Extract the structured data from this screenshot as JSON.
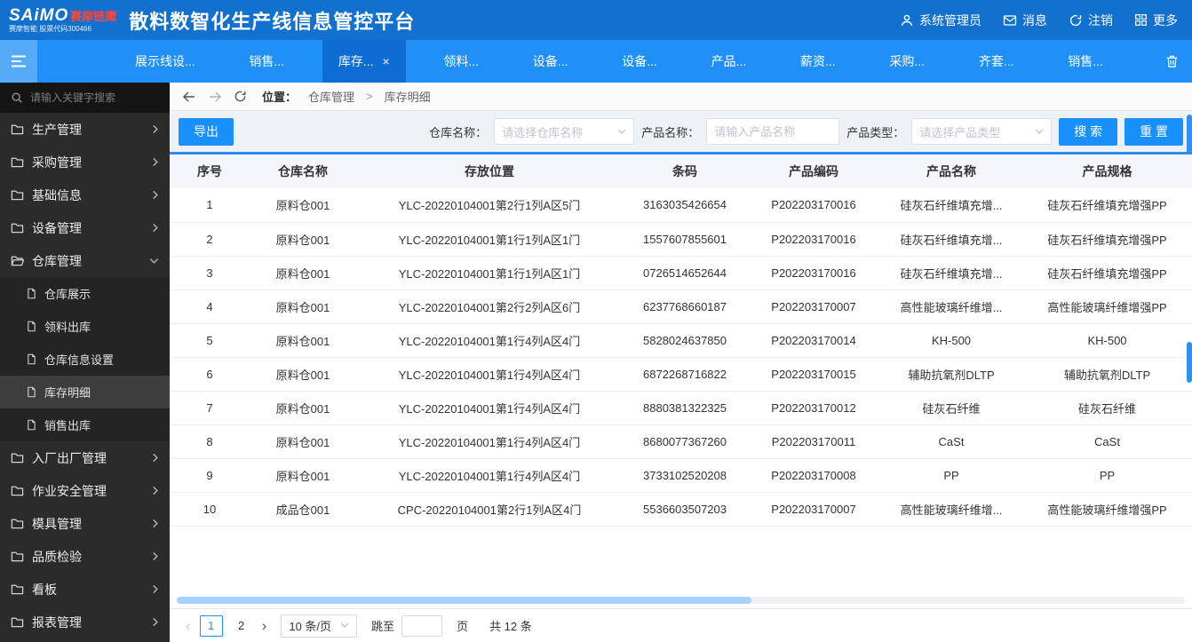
{
  "colors": {
    "primary": "#1890ff",
    "topbar": "#1270cf",
    "tabbar": "#2090f8",
    "tab_active": "#0e6dd2",
    "sidebar": "#2b2b2b",
    "accent": "#2e90f5"
  },
  "header": {
    "logo_main": "SAiMO",
    "logo_sub": "赛摩链鹰",
    "logo_tagline": "赛摩智能 股票代码300466",
    "title": "散料数智化生产线信息管控平台",
    "user": "系统管理员",
    "messages": "消息",
    "logout": "注销",
    "more": "更多"
  },
  "tabbar": {
    "tabs": [
      {
        "label": "展示线设...",
        "active": false
      },
      {
        "label": "销售...",
        "active": false
      },
      {
        "label": "库存...",
        "active": true
      },
      {
        "label": "领料...",
        "active": false
      },
      {
        "label": "设备...",
        "active": false
      },
      {
        "label": "设备...",
        "active": false
      },
      {
        "label": "产品...",
        "active": false
      },
      {
        "label": "薪资...",
        "active": false
      },
      {
        "label": "采购...",
        "active": false
      },
      {
        "label": "齐套...",
        "active": false
      },
      {
        "label": "销售...",
        "active": false
      }
    ]
  },
  "sidebar": {
    "search_placeholder": "请输入关键字搜索",
    "menu": [
      {
        "label": "生产管理",
        "expanded": false
      },
      {
        "label": "采购管理",
        "expanded": false
      },
      {
        "label": "基础信息",
        "expanded": false
      },
      {
        "label": "设备管理",
        "expanded": false
      },
      {
        "label": "仓库管理",
        "expanded": true,
        "active_child": "库存明细",
        "children": [
          "仓库展示",
          "领料出库",
          "仓库信息设置",
          "库存明细",
          "销售出库"
        ]
      },
      {
        "label": "入厂出厂管理",
        "expanded": false
      },
      {
        "label": "作业安全管理",
        "expanded": false
      },
      {
        "label": "模具管理",
        "expanded": false
      },
      {
        "label": "品质检验",
        "expanded": false
      },
      {
        "label": "看板",
        "expanded": false
      },
      {
        "label": "报表管理",
        "expanded": false
      }
    ]
  },
  "breadcrumb": {
    "location_label": "位置：",
    "parent": "仓库管理",
    "separator": ">",
    "current": "库存明细"
  },
  "filters": {
    "export_label": "导出",
    "warehouse_label": "仓库名称：",
    "warehouse_placeholder": "请选择仓库名称",
    "product_name_label": "产品名称：",
    "product_name_placeholder": "请输入产品名称",
    "product_type_label": "产品类型：",
    "product_type_placeholder": "请选择产品类型",
    "search_label": "搜 索",
    "reset_label": "重 置"
  },
  "table": {
    "headers": [
      "序号",
      "仓库名称",
      "存放位置",
      "条码",
      "产品编码",
      "产品名称",
      "产品规格"
    ],
    "rows": [
      [
        "1",
        "原料仓001",
        "YLC-20220104001第2行1列A区5门",
        "3163035426654",
        "P202203170016",
        "硅灰石纤维填充增...",
        "硅灰石纤维填充增强PP"
      ],
      [
        "2",
        "原料仓001",
        "YLC-20220104001第1行1列A区1门",
        "1557607855601",
        "P202203170016",
        "硅灰石纤维填充增...",
        "硅灰石纤维填充增强PP"
      ],
      [
        "3",
        "原料仓001",
        "YLC-20220104001第1行1列A区1门",
        "0726514652644",
        "P202203170016",
        "硅灰石纤维填充增...",
        "硅灰石纤维填充增强PP"
      ],
      [
        "4",
        "原料仓001",
        "YLC-20220104001第2行2列A区6门",
        "6237768660187",
        "P202203170007",
        "高性能玻璃纤维增...",
        "高性能玻璃纤维增强PP"
      ],
      [
        "5",
        "原料仓001",
        "YLC-20220104001第1行4列A区4门",
        "5828024637850",
        "P202203170014",
        "KH-500",
        "KH-500"
      ],
      [
        "6",
        "原料仓001",
        "YLC-20220104001第1行4列A区4门",
        "6872268716822",
        "P202203170015",
        "辅助抗氧剂DLTP",
        "辅助抗氧剂DLTP"
      ],
      [
        "7",
        "原料仓001",
        "YLC-20220104001第1行4列A区4门",
        "8880381322325",
        "P202203170012",
        "硅灰石纤维",
        "硅灰石纤维"
      ],
      [
        "8",
        "原料仓001",
        "YLC-20220104001第1行4列A区4门",
        "8680077367260",
        "P202203170011",
        "CaSt",
        "CaSt"
      ],
      [
        "9",
        "原料仓001",
        "YLC-20220104001第1行4列A区4门",
        "3733102520208",
        "P202203170008",
        "PP",
        "PP"
      ],
      [
        "10",
        "成品仓001",
        "CPC-20220104001第2行1列A区4门",
        "5536603507203",
        "P202203170007",
        "高性能玻璃纤维增...",
        "高性能玻璃纤维增强PP"
      ]
    ]
  },
  "pagination": {
    "prev": "‹",
    "next": "›",
    "pages": [
      "1",
      "2"
    ],
    "current_page": "1",
    "page_size": "10 条/页",
    "jump_label": "跳至",
    "page_unit": "页",
    "total": "共 12 条"
  }
}
